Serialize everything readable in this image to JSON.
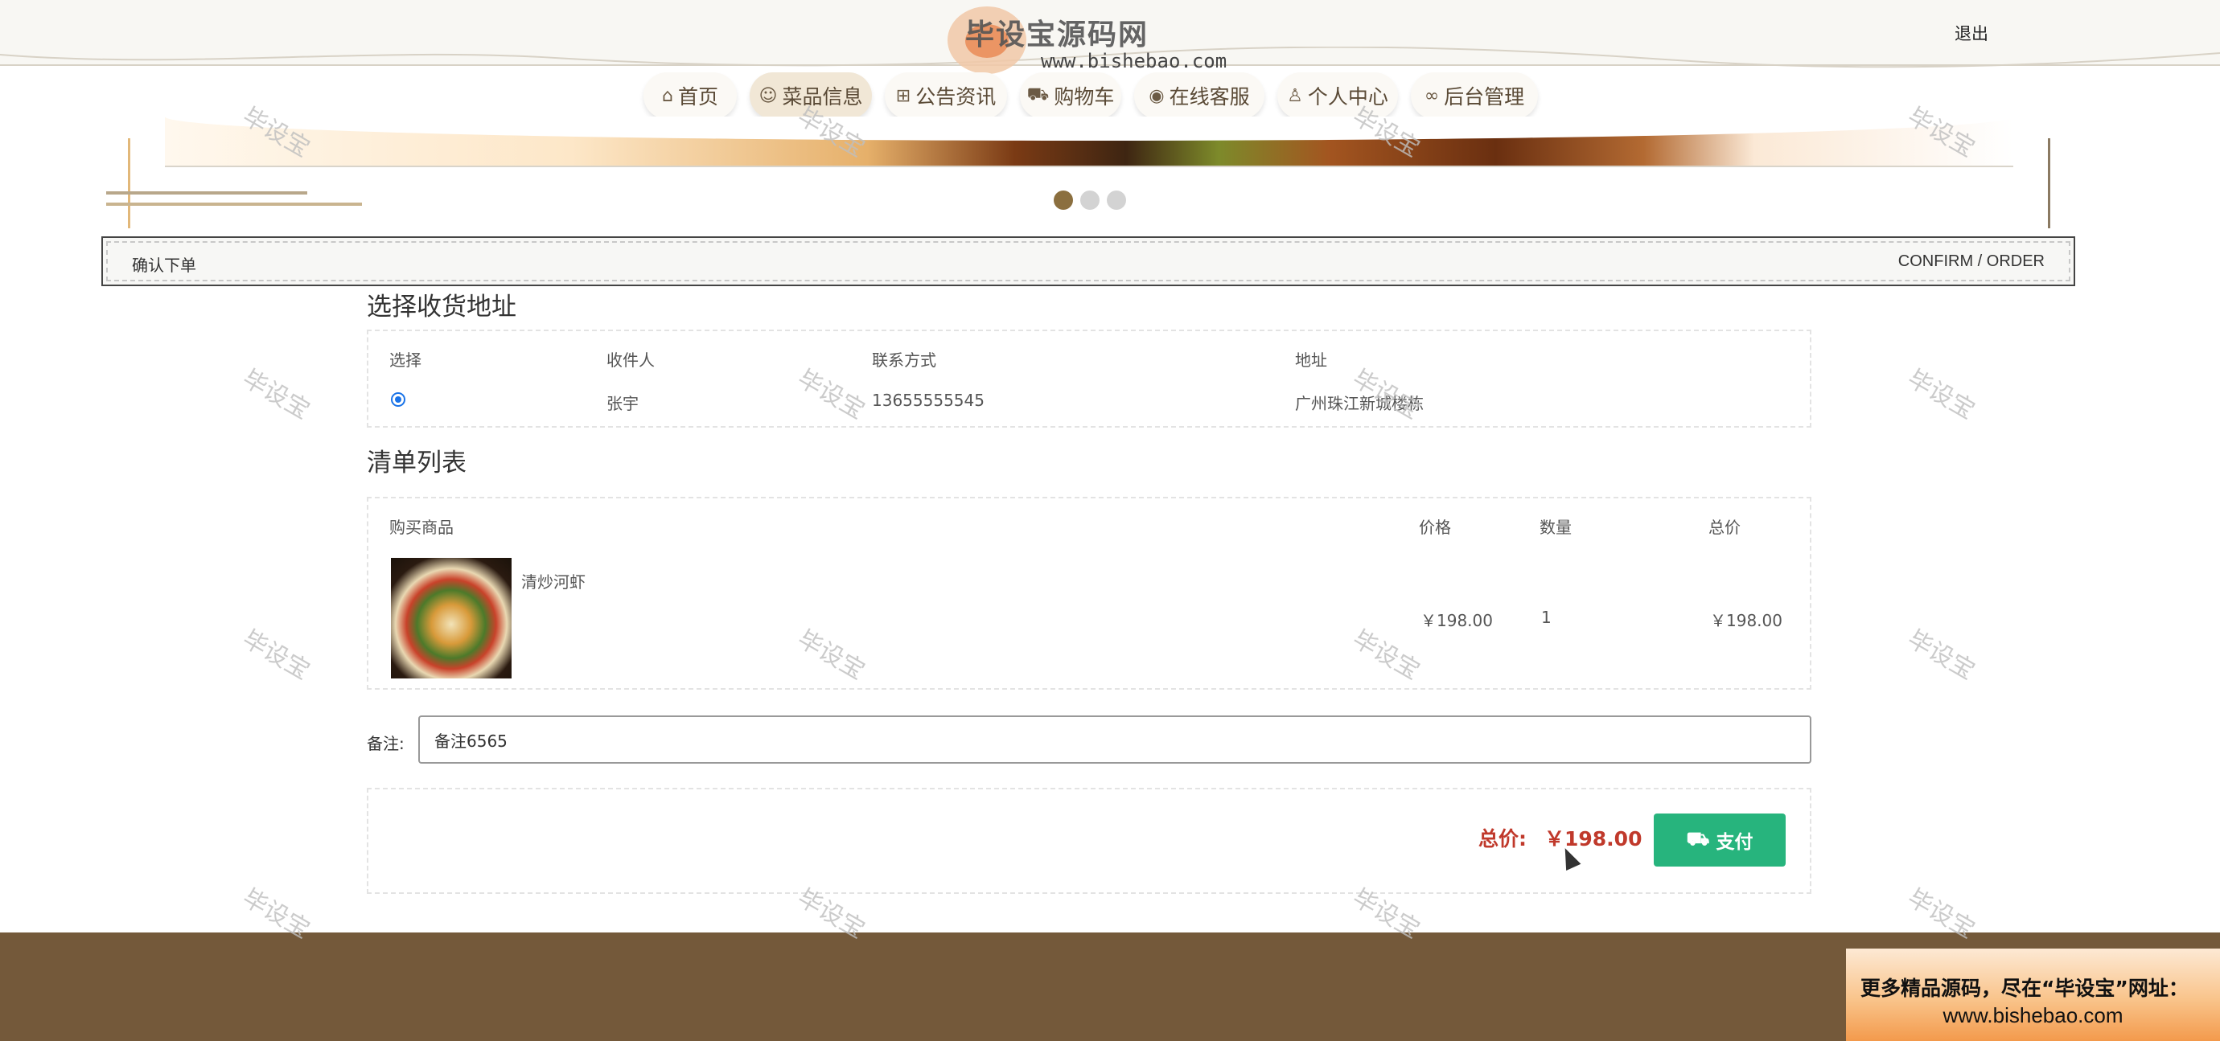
{
  "header": {
    "site_title": "毕设宝源码网",
    "site_url": "www.bishebao.com",
    "logout_label": "退出"
  },
  "nav": {
    "items": [
      {
        "label": "首页",
        "icon": "home-icon",
        "active": false
      },
      {
        "label": "菜品信息",
        "icon": "smile-icon",
        "active": true
      },
      {
        "label": "公告资讯",
        "icon": "gift-icon",
        "active": false
      },
      {
        "label": "购物车",
        "icon": "cart-icon",
        "active": false
      },
      {
        "label": "在线客服",
        "icon": "globe-icon",
        "active": false
      },
      {
        "label": "个人中心",
        "icon": "user-icon",
        "active": false
      },
      {
        "label": "后台管理",
        "icon": "link-icon",
        "active": false
      }
    ]
  },
  "carousel": {
    "slide_count": 3,
    "active_index": 0
  },
  "breadcrumb": {
    "title": "确认下单",
    "subtitle_en": "CONFIRM / ORDER"
  },
  "address_section": {
    "title": "选择收货地址",
    "headers": [
      "选择",
      "收件人",
      "联系方式",
      "地址"
    ],
    "rows": [
      {
        "selected": true,
        "recipient": "张宇",
        "phone": "13655555545",
        "address": "广州珠江新城楼栋"
      }
    ]
  },
  "order_section": {
    "title": "清单列表",
    "headers": [
      "购买商品",
      "价格",
      "数量",
      "总价"
    ],
    "items": [
      {
        "name": "清炒河虾",
        "price": "￥198.00",
        "quantity": "1",
        "total": "￥198.00"
      }
    ]
  },
  "remark": {
    "label": "备注:",
    "value": "备注6565"
  },
  "summary": {
    "total_label": "总价:",
    "total_value": "￥198.00",
    "pay_label": "支付"
  },
  "promo": {
    "line1": "更多精品源码，尽在“毕设宝”网址：",
    "line2": "www.bishebao.com"
  },
  "watermark": {
    "text": "毕设宝"
  },
  "colors": {
    "accent": "#8b6f3f",
    "footer": "#74593a",
    "price_red": "#c0392b",
    "pay_green": "#27b47d",
    "radio_blue": "#1a73e8"
  }
}
